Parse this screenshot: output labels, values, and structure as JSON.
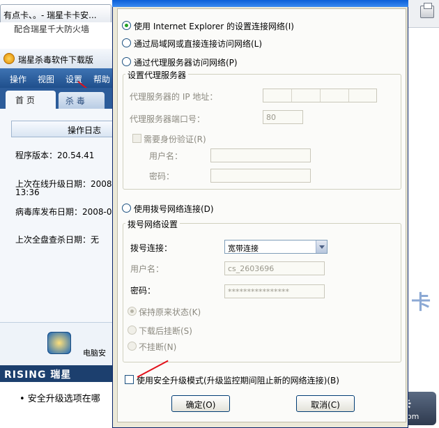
{
  "background": {
    "browser_tab_title": "有点卡、。- 瑞星卡卡安...",
    "page_text_top": "配合瑞星千大防火墙",
    "app": {
      "title": "瑞星杀毒软件下载版",
      "menu": [
        "操作",
        "视图",
        "设置",
        "帮助"
      ],
      "tabs": [
        "首 页",
        "杀 毒"
      ],
      "log_header": "操作日志",
      "program_version": "程序版本：20.54.41",
      "last_update_line1": "上次在线升级日期：2008",
      "last_update_line2": "13:36",
      "virus_db_date": "病毒库发布日期：2008-0",
      "last_full_scan": "上次全盘查杀日期：无",
      "pc_label": "电脑安",
      "brand": "RISING 瑞星"
    },
    "bottom_text": "• 安全升级选项在哪",
    "watermark_glyph": "卡",
    "logo_badge": {
      "name": "瑞星卡卡",
      "url": "www.ikaka.com"
    }
  },
  "dialog": {
    "options": {
      "ie_settings": "使用 Internet Explorer 的设置连接网络(I)",
      "lan_direct": "通过局域网或直接连接访问网络(L)",
      "proxy": "通过代理服务器访问网络(P)",
      "dialup": "使用拨号网络连接(D)"
    },
    "proxy_group": {
      "title": "设置代理服务器",
      "ip_label": "代理服务器的 IP 地址：",
      "port_label": "代理服务器端口号：",
      "port_value": "80",
      "auth_label": "需要身份验证(R)",
      "user_label": "用户名：",
      "pass_label": "密码："
    },
    "dialup_group": {
      "title": "拨号网络设置",
      "conn_label": "拨号连接：",
      "conn_value": "宽带连接",
      "user_label": "用户名：",
      "user_value": "cs_2603696",
      "pass_label": "密码：",
      "pass_value": "****************",
      "keep_state": "保持原来状态(K)",
      "hangup_after": "下载后挂断(S)",
      "no_hangup": "不挂断(N)"
    },
    "safe_mode": "使用安全升级模式(升级监控期间阻止新的网络连接)(B)",
    "ok": "确定(O)",
    "cancel": "取消(C)"
  },
  "colors": {
    "accent_red": "#e2101a",
    "dialog_bg": "#ece9d8",
    "selected_radio": "#21a121"
  }
}
